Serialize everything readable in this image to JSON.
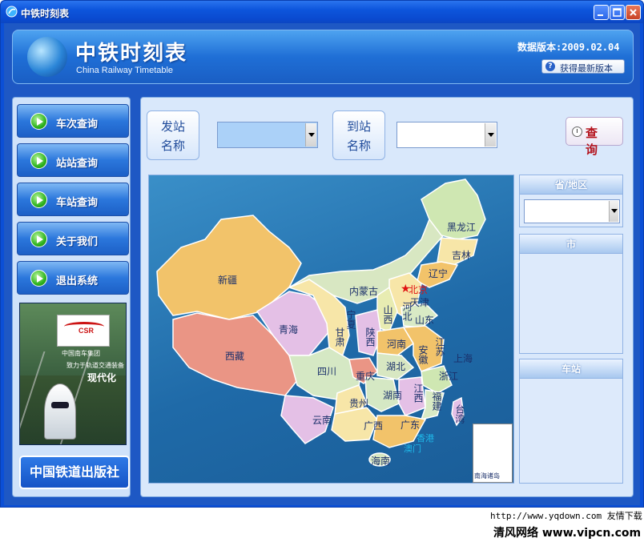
{
  "window": {
    "title": "中铁时刻表"
  },
  "header": {
    "app_title": "中铁时刻表",
    "app_subtitle": "China Railway Timetable",
    "data_version": "数据版本:2009.02.04",
    "update_button": "获得最新版本"
  },
  "sidebar": {
    "items": [
      {
        "label": "车次查询"
      },
      {
        "label": "站站查询"
      },
      {
        "label": "车站查询"
      },
      {
        "label": "关于我们"
      },
      {
        "label": "退出系统"
      }
    ],
    "promo": {
      "brand": "CSR",
      "company": "中国南车集团",
      "tagline": "致力于轨道交通装备",
      "tagline2": "现代化"
    },
    "publisher": "中国铁道出版社"
  },
  "query": {
    "from_label_1": "发站",
    "from_label_2": "名称",
    "to_label_1": "到站",
    "to_label_2": "名称",
    "from_value": "",
    "to_value": "",
    "query_button": "查 询"
  },
  "map": {
    "provinces": [
      {
        "name": "黑龙江"
      },
      {
        "name": "吉林"
      },
      {
        "name": "辽宁"
      },
      {
        "name": "内蒙古"
      },
      {
        "name": "北京"
      },
      {
        "name": "天津"
      },
      {
        "name": "河北"
      },
      {
        "name": "山西"
      },
      {
        "name": "山东"
      },
      {
        "name": "宁夏"
      },
      {
        "name": "甘肃"
      },
      {
        "name": "陕西"
      },
      {
        "name": "河南"
      },
      {
        "name": "江苏"
      },
      {
        "name": "上海"
      },
      {
        "name": "安徽"
      },
      {
        "name": "新疆"
      },
      {
        "name": "青海"
      },
      {
        "name": "西藏"
      },
      {
        "name": "四川"
      },
      {
        "name": "重庆"
      },
      {
        "name": "湖北"
      },
      {
        "name": "浙江"
      },
      {
        "name": "贵州"
      },
      {
        "name": "湖南"
      },
      {
        "name": "江西"
      },
      {
        "name": "福建"
      },
      {
        "name": "台湾"
      },
      {
        "name": "云南"
      },
      {
        "name": "广西"
      },
      {
        "name": "广东"
      },
      {
        "name": "香港"
      },
      {
        "name": "澳门"
      },
      {
        "name": "海南"
      }
    ],
    "inset_label": "南海诸岛"
  },
  "right_panels": {
    "province_header": "省/地区",
    "province_value": "",
    "city_header": "市",
    "station_header": "车站"
  },
  "watermark": {
    "line1": "http://www.yqdown.com 友情下载",
    "line2": "清风网络 www.vipcn.com"
  },
  "colors": {
    "window_blue": "#0b4fd6",
    "panel_bg": "#d9e8fb",
    "sea": "#1f6aa8",
    "query_red": "#b4141e",
    "capital_star": "#e01010"
  }
}
